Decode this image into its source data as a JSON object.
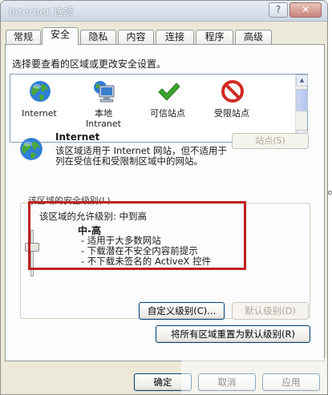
{
  "window": {
    "title": "Internet 选项",
    "help": "?",
    "close": "✕"
  },
  "tabs": [
    {
      "label": "常规"
    },
    {
      "label": "安全"
    },
    {
      "label": "隐私"
    },
    {
      "label": "内容"
    },
    {
      "label": "连接"
    },
    {
      "label": "程序"
    },
    {
      "label": "高级"
    }
  ],
  "active_tab": "安全",
  "security": {
    "zone_prompt": "选择要查看的区域或更改安全设置。",
    "zones": [
      {
        "label": "Internet",
        "icon": "globe-icon"
      },
      {
        "label": "本地\nIntranet",
        "icon": "computer-icon"
      },
      {
        "label": "可信站点",
        "icon": "checkmark-icon"
      },
      {
        "label": "受限站点",
        "icon": "no-entry-icon"
      }
    ],
    "selected_zone": {
      "name": "Internet",
      "description": "该区域适用于 Internet 网站，但不适用于列在受信任和受限制区域中的网站。"
    },
    "sites_button": "站点(S)",
    "level_legend": "该区域的安全级别(L)",
    "allowed_levels": "该区域的允许级别: 中到高",
    "level_title": "中-高",
    "level_items": [
      "- 适用于大多数网站",
      "- 下载潜在不安全内容前提示",
      "- 不下载未签名的 ActiveX 控件"
    ],
    "custom_level_button": "自定义级别(C)...",
    "default_level_button": "默认级别(D)",
    "reset_all_button": "将所有区域重置为默认级别(R)"
  },
  "footer": {
    "ok": "确定",
    "cancel": "取消",
    "apply": "应用"
  },
  "colors": {
    "highlight": "#c0211f",
    "panel": "#fcfcfe",
    "dialog": "#ece9d8"
  }
}
